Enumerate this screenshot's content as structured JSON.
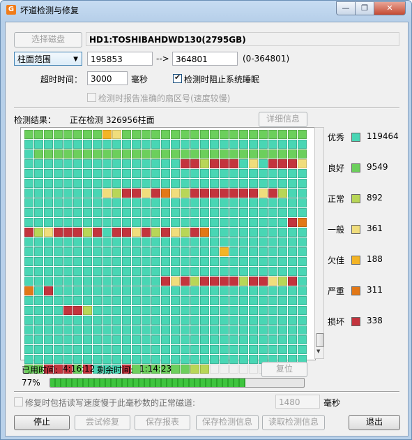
{
  "window": {
    "title": "坏道检测与修复",
    "controls": {
      "min": "—",
      "max": "❐",
      "close": "✕"
    }
  },
  "disk": {
    "select_button": "选择磁盘",
    "name": "HD1:TOSHIBAHDWD130(2795GB)"
  },
  "range": {
    "mode": "柱面范围",
    "start": "195853",
    "arrow": "-->",
    "end": "364801",
    "limit": "(0-364801)"
  },
  "timeout": {
    "label": "超时时间：",
    "value": "3000",
    "unit": "毫秒",
    "prevent_sleep_label": "检测时阻止系统睡眠",
    "prevent_sleep_checked": true
  },
  "accurate_sector": {
    "label": "检测时报告准确的扇区号(速度较慢)",
    "checked": false
  },
  "result": {
    "label": "检测结果：",
    "status": "正在检测 326956柱面",
    "detail_button": "详细信息"
  },
  "legend": [
    {
      "label": "优秀",
      "count": "119464",
      "color": "#49d6b4"
    },
    {
      "label": "良好",
      "count": "9549",
      "color": "#6ccf5c"
    },
    {
      "label": "正常",
      "count": "892",
      "color": "#b8d657"
    },
    {
      "label": "一般",
      "count": "361",
      "color": "#f0dd7c"
    },
    {
      "label": "欠佳",
      "count": "188",
      "color": "#f3b425"
    },
    {
      "label": "严重",
      "count": "311",
      "color": "#e27817"
    },
    {
      "label": "损坏",
      "count": "338",
      "color": "#c3343d"
    }
  ],
  "pending_color": "#f0f0f0",
  "time": {
    "elapsed_label": "已用时间:",
    "elapsed": "4:16:12",
    "remaining_label": "剩余时间:",
    "remaining": "1:14:23",
    "reset_button": "复位"
  },
  "progress": {
    "percent_text": "77%",
    "value": 0.77
  },
  "repair_option": {
    "label": "修复时包括读写速度慢于此毫秒数的正常磁道:",
    "value": "1480",
    "unit": "毫秒",
    "checked": false
  },
  "buttons": {
    "stop": "停止",
    "try_repair": "尝试修复",
    "save_report": "保存报表",
    "save_info": "保存检测信息",
    "read_info": "读取检测信息",
    "exit": "退出"
  },
  "grid": {
    "cols": 29,
    "rows": [
      "bbbbbbbbedbbbbbbbbbbbbbbbbbbb",
      "aaaaaaaaaaaaaaaaaaaaaaaaaaaaa",
      "abbbbbbbbbbbbbbbbbbbbbbbbbbbb",
      "aaaaaaaaaaaaaaaaggcgggadagggd",
      "aaaaaaaaaaaaaaaaaaaaaaaaaaaaa",
      "aaaaaaaaaaaaaaaaaaaaaaaaaaaaa",
      "aaaaaaaadcggdgfdcgggggggdgcaa",
      "aaaaaaaaaaaaaaaaaaaaaaaaaaaaa",
      "aaaaaaaaaaaaaaaaaaaaaaaaaaaaa",
      "aaaaaaaaaaaaaaaaaaaaaaaaaaagf",
      "gcdgggcgaggdgcgdcgfaaaaaaaaaa",
      "aaaaaaaaaaaaaaaaaaaaaaaaaaaaa",
      "aaaaaaaaaaaaaaaaaaaaeaaaaaaaa",
      "aaaaaaaaaaaaaaaaaaaaaaaaaaaaa",
      "aaaaaaaaaaaaaaaaaaaaaaaaaaaaa",
      "aaaaaaaaaaaaaagdgcggggcggdcga",
      "fagaaaaaaaaaaaaaaaaaaaaaaaaaa",
      "aaaaaaaaaaaaaaaaaaaaaaaaaaaaa",
      "aaaaggcaaaaaaaaaaaaaaaaaaaaaa",
      "aaaaaaaaaaaaaaaaaaaaaaaaaaaaa",
      "aaaaaaaaaaaaaaaaaaaaaaaaaaaaa",
      "aaaaaaaaaaaaaaaaaaaaaaaaaaaaa",
      "aaaaaaaaaaaaaaaaaaaaaaaaaaaaa",
      "aaaaaaaaaaaaaaaaaaaaaaaaaaaaa"
    ]
  }
}
